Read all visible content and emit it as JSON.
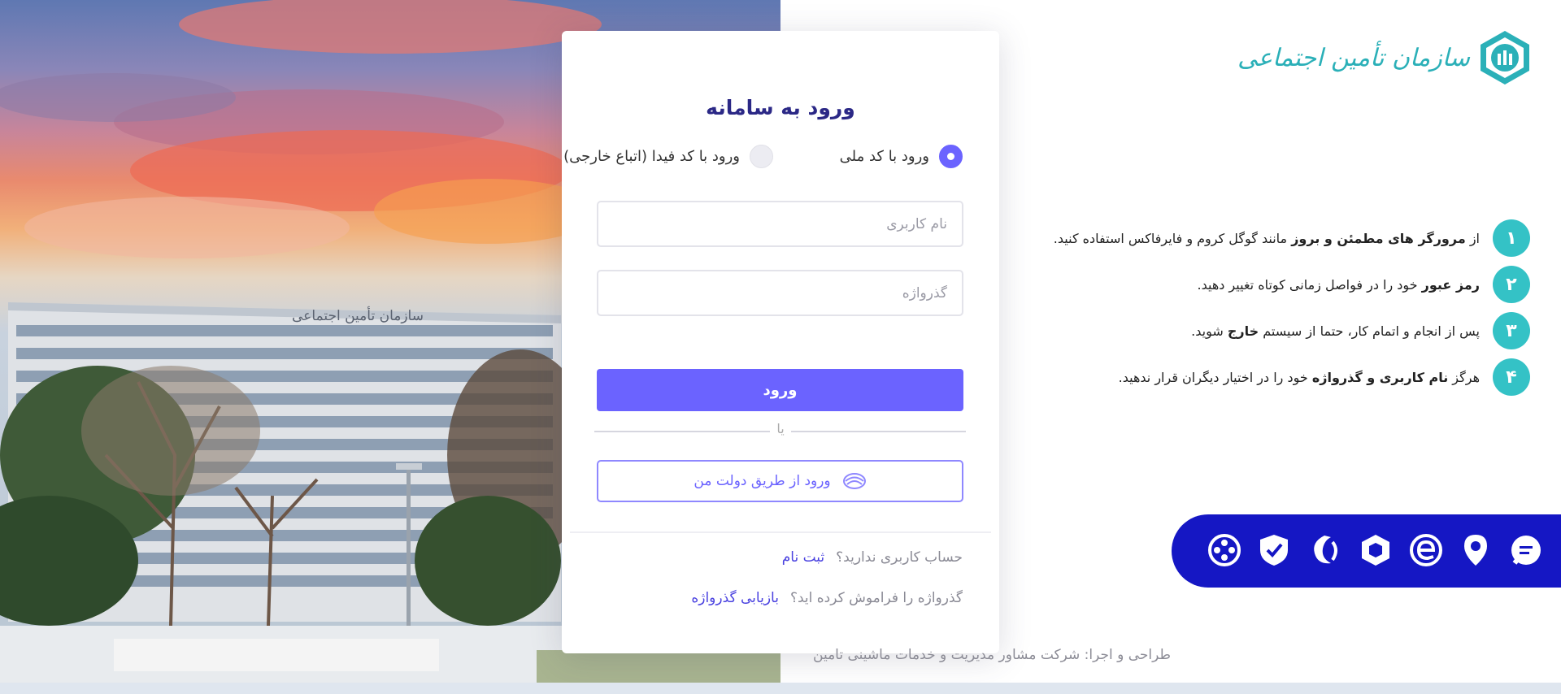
{
  "card": {
    "title": "ورود به سامانه",
    "radio_options": [
      "ورود با کد ملی",
      "ورود با کد فیدا (اتباع خارجی)"
    ],
    "selected_option": "ورود با کد ملی",
    "username_placeholder": "نام کاربری",
    "password_placeholder": "گذرواژه",
    "login_button": "ورود",
    "divider_text": "یا",
    "dolat_button": "ورود از طریق دولت من",
    "no_account_text": "حساب کاربری ندارید؟",
    "register_link": "ثبت نام",
    "forgot_text": "گذرواژه را فراموش کرده اید؟",
    "recover_link": "بازیابی گذرواژه"
  },
  "logo": {
    "text": "سازمان تأمین اجتماعی"
  },
  "photo": {
    "building_sign": "سازمان تأمین اجتماعی"
  },
  "tips": [
    {
      "number": "۱",
      "before": "از ",
      "bold": "مرورگر های مطمئن و بروز",
      "after": " مانند گوگل کروم و فایرفاکس استفاده کنید."
    },
    {
      "number": "۲",
      "before": "",
      "bold": "رمز عبور",
      "after": " خود را در فواصل زمانی کوتاه تغییر دهید."
    },
    {
      "number": "۳",
      "before": "پس از انجام و اتمام کار، حتما از سیستم ",
      "bold": "خارج",
      "after": " شوید."
    },
    {
      "number": "۴",
      "before": "هرگز ",
      "bold": "نام کاربری و گذرواژه",
      "after": " خود را در اختیار دیگران قرار ندهید."
    }
  ],
  "service_icons": [
    "chat-service-icon",
    "location-service-icon",
    "e-service-icon",
    "hexagon-service-icon",
    "swirl-service-icon",
    "shield-check-service-icon",
    "film-reel-service-icon"
  ],
  "footer": {
    "credit": "طراحی و اجرا: شرکت مشاور مدیریت و خدمات ماشینی تامین"
  },
  "colors": {
    "accent": "#6b63ff",
    "title": "#2b2886",
    "teal": "#34c2c6",
    "services_bar": "#1517c4"
  }
}
